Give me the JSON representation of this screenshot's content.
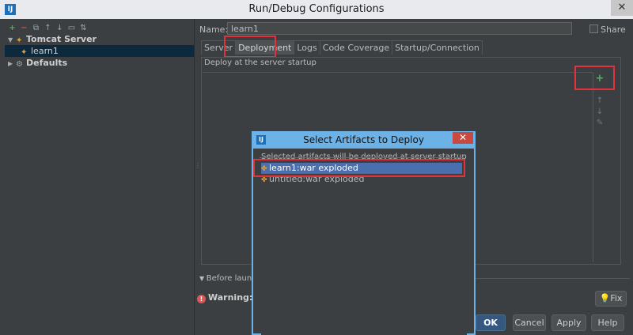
{
  "window": {
    "title": "Run/Debug Configurations",
    "app_icon": "IJ",
    "close": "✕"
  },
  "toolbar": {
    "add": "+",
    "remove": "−",
    "copy": "⧉",
    "move_up": "↑",
    "move_down": "↓",
    "folder": "▭",
    "sort": "⇅"
  },
  "tree": {
    "tomcat": "Tomcat Server",
    "learn1": "learn1",
    "defaults": "Defaults"
  },
  "config": {
    "name_label": "Name:",
    "name_value": "learn1",
    "share_label": "Share"
  },
  "tabs": [
    "Server",
    "Deployment",
    "Logs",
    "Code Coverage",
    "Startup/Connection"
  ],
  "deployment": {
    "header": "Deploy at the server startup",
    "add": "+"
  },
  "before_launch": "Before launch:",
  "warning": "Warning: No",
  "fix": "Fix",
  "buttons": {
    "ok": "OK",
    "cancel": "Cancel",
    "apply": "Apply",
    "help": "Help"
  },
  "modal": {
    "title": "Select Artifacts to Deploy",
    "icon": "IJ",
    "close": "✕",
    "description": "Selected artifacts will be deployed at server startup",
    "artifacts": [
      "learn1:war exploded",
      "untitled:war exploded"
    ]
  }
}
